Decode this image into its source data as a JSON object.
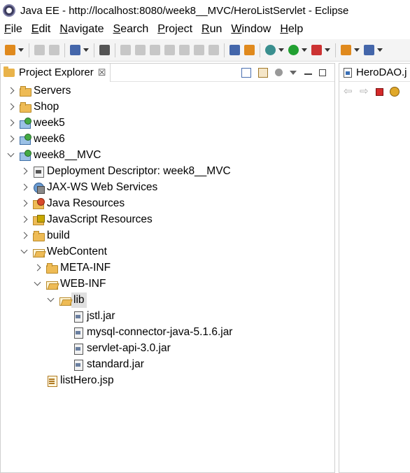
{
  "window": {
    "title": "Java EE - http://localhost:8080/week8__MVC/HeroListServlet - Eclipse"
  },
  "menubar": {
    "items": [
      "File",
      "Edit",
      "Navigate",
      "Search",
      "Project",
      "Run",
      "Window",
      "Help"
    ]
  },
  "toolbar": {
    "icons": [
      "new-icon",
      "save-icon",
      "save-all-icon",
      "console-icon",
      "skip-breakpoints-icon",
      "resume-icon",
      "suspend-icon",
      "terminate-icon",
      "disconnect-icon",
      "step-into-icon",
      "step-over-icon",
      "step-return-icon",
      "toggle-icon",
      "external-tools-icon",
      "debug-icon",
      "run-icon",
      "server-run-icon",
      "new-server-icon",
      "new-java-class-icon"
    ]
  },
  "explorer": {
    "tab_label": "Project Explorer",
    "close_glyph": "☒",
    "tree": [
      {
        "label": "Servers",
        "depth": 0,
        "expanded": false,
        "icon": "folder-icon"
      },
      {
        "label": "Shop",
        "depth": 0,
        "expanded": false,
        "icon": "folder-icon"
      },
      {
        "label": "week5",
        "depth": 0,
        "expanded": false,
        "icon": "web-project-icon"
      },
      {
        "label": "week6",
        "depth": 0,
        "expanded": false,
        "icon": "web-project-icon"
      },
      {
        "label": "week8__MVC",
        "depth": 0,
        "expanded": true,
        "icon": "web-project-icon"
      },
      {
        "label": "Deployment Descriptor: week8__MVC",
        "depth": 1,
        "expanded": false,
        "icon": "deployment-descriptor-icon"
      },
      {
        "label": "JAX-WS Web Services",
        "depth": 1,
        "expanded": false,
        "icon": "web-services-icon"
      },
      {
        "label": "Java Resources",
        "depth": 1,
        "expanded": false,
        "icon": "java-resources-icon"
      },
      {
        "label": "JavaScript Resources",
        "depth": 1,
        "expanded": false,
        "icon": "javascript-resources-icon"
      },
      {
        "label": "build",
        "depth": 1,
        "expanded": false,
        "icon": "folder-icon"
      },
      {
        "label": "WebContent",
        "depth": 1,
        "expanded": true,
        "icon": "folder-open-icon"
      },
      {
        "label": "META-INF",
        "depth": 2,
        "expanded": false,
        "icon": "folder-icon"
      },
      {
        "label": "WEB-INF",
        "depth": 2,
        "expanded": true,
        "icon": "folder-open-icon"
      },
      {
        "label": "lib",
        "depth": 3,
        "expanded": true,
        "icon": "folder-open-icon",
        "selected": true
      },
      {
        "label": "jstl.jar",
        "depth": 4,
        "leaf": true,
        "icon": "jar-icon"
      },
      {
        "label": "mysql-connector-java-5.1.6.jar",
        "depth": 4,
        "leaf": true,
        "icon": "jar-icon"
      },
      {
        "label": "servlet-api-3.0.jar",
        "depth": 4,
        "leaf": true,
        "icon": "jar-icon"
      },
      {
        "label": "standard.jar",
        "depth": 4,
        "leaf": true,
        "icon": "jar-icon"
      },
      {
        "label": "listHero.jsp",
        "depth": 2,
        "leaf": true,
        "icon": "jsp-file-icon"
      }
    ]
  },
  "editor": {
    "tab_label": "HeroDAO.j"
  }
}
